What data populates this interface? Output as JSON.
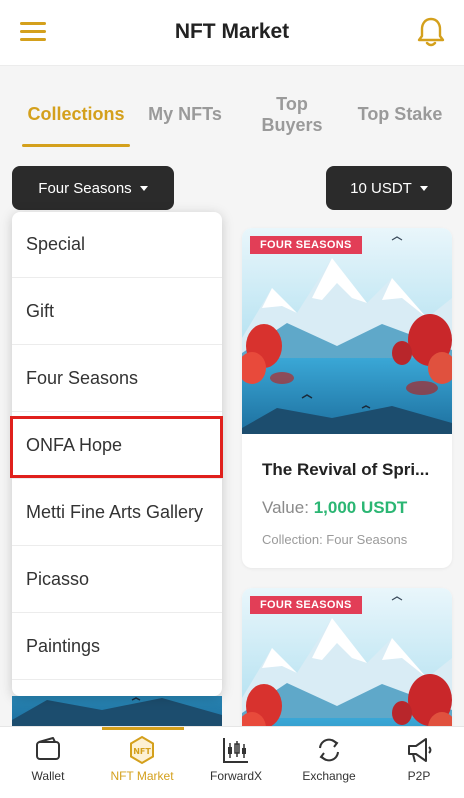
{
  "header": {
    "title": "NFT Market",
    "menu_icon": "hamburger-menu-icon",
    "bell_icon": "bell-icon",
    "accent": "#d4a01c"
  },
  "tabs": [
    {
      "label": "Collections",
      "active": true
    },
    {
      "label": "My NFTs",
      "active": false
    },
    {
      "label": "Top Buyers",
      "line1": "Top",
      "line2": "Buyers",
      "active": false
    },
    {
      "label": "Top Stake",
      "active": false
    }
  ],
  "filters": {
    "collection": "Four Seasons",
    "price": "10 USDT"
  },
  "dropdown": {
    "items": [
      "Special",
      "Gift",
      "Four Seasons",
      "ONFA Hope",
      "Metti Fine Arts Gallery",
      "Picasso",
      "Paintings"
    ],
    "highlighted": "ONFA Hope"
  },
  "cards": [
    {
      "badge": "FOUR SEASONS",
      "name": "The Revival of Spri...",
      "value_label": "Value:",
      "value": "1,000 USDT",
      "collection": "Collection: Four Seasons"
    },
    {
      "badge": "FOUR SEASONS"
    }
  ],
  "bottom_nav": [
    {
      "label": "Wallet",
      "icon": "wallet-icon",
      "active": false
    },
    {
      "label": "NFT Market",
      "icon": "nft-icon",
      "active": true
    },
    {
      "label": "ForwardX",
      "icon": "chart-candles-icon",
      "active": false
    },
    {
      "label": "Exchange",
      "icon": "exchange-icon",
      "active": false
    },
    {
      "label": "P2P",
      "icon": "megaphone-icon",
      "active": false
    }
  ]
}
